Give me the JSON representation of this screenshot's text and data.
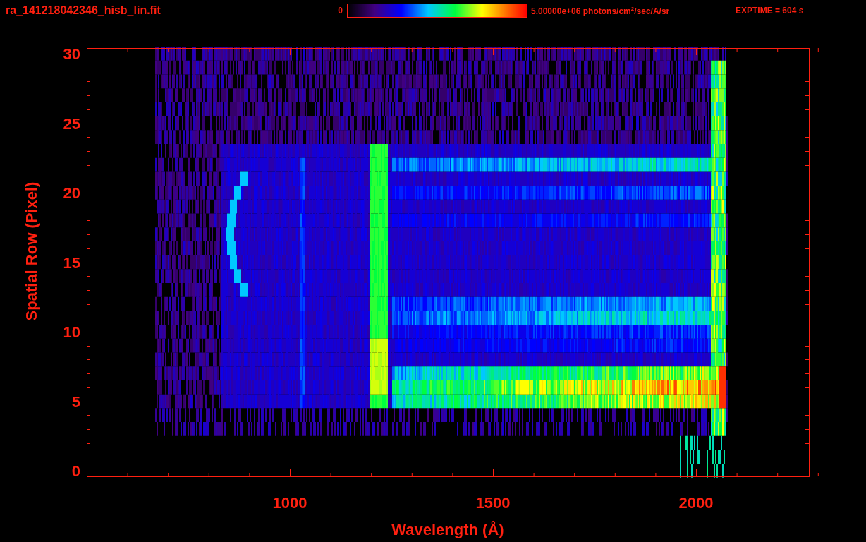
{
  "header": {
    "title": "ra_141218042346_hisb_lin.fit",
    "colorbar_min": "0",
    "colorbar_max": "5.00000e+06 photons/cm$^{2}$/sec/A/sr",
    "exposure": "EXPTIME = 604 s"
  },
  "plot": {
    "xlabel": "Wavelength (Å)",
    "ylabel": "Spatial Row (Pixel)",
    "xticks": [
      "1000",
      "1500",
      "2000"
    ],
    "yticks": [
      "30",
      "25",
      "20",
      "15",
      "10",
      "5",
      "0"
    ]
  }
}
